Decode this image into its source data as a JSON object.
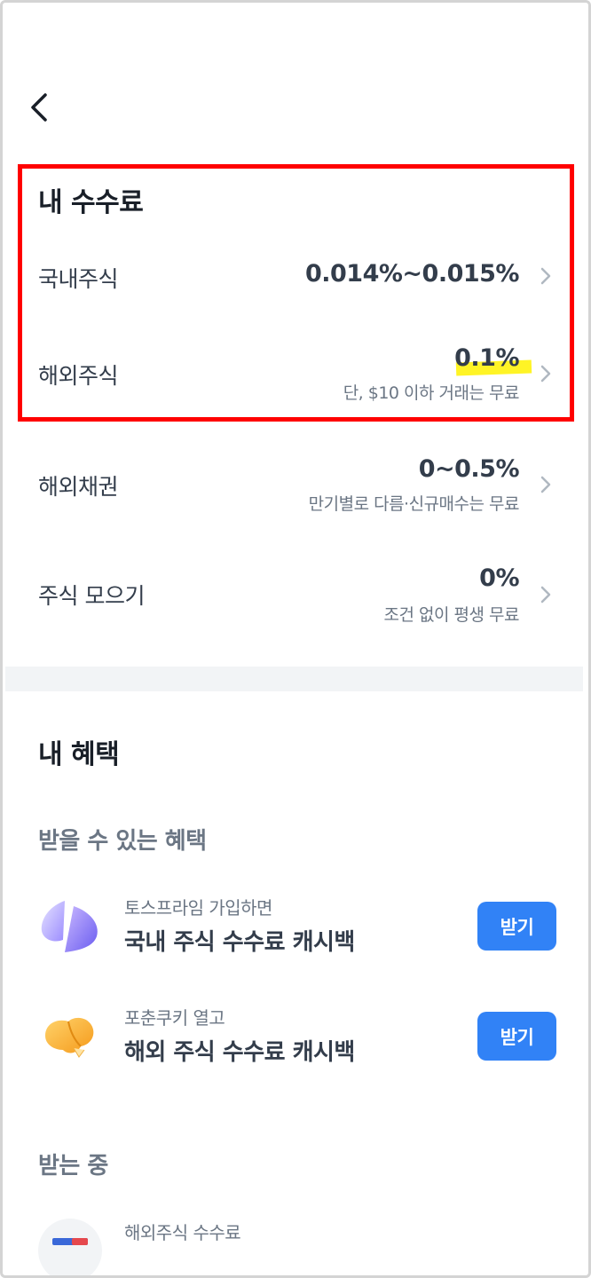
{
  "nav": {
    "back_icon": "chevron-left-icon"
  },
  "fees": {
    "title": "내 수수료",
    "rows": [
      {
        "label": "국내주식",
        "rate": "0.014%~0.015%",
        "note": ""
      },
      {
        "label": "해외주식",
        "rate": "0.1%",
        "note": "단, $10 이하 거래는 무료"
      },
      {
        "label": "해외채권",
        "rate": "0~0.5%",
        "note": "만기별로 다름·신규매수는 무료"
      },
      {
        "label": "주식 모으기",
        "rate": "0%",
        "note": "조건 없이 평생 무료"
      }
    ]
  },
  "benefits": {
    "title": "내 혜택",
    "available_title": "받을 수 있는 혜택",
    "available": [
      {
        "sub": "토스프라임 가입하면",
        "main": "국내 주식 수수료 캐시백",
        "button": "받기",
        "icon": "prime-icon"
      },
      {
        "sub": "포춘쿠키 열고",
        "main": "해외 주식 수수료 캐시백",
        "button": "받기",
        "icon": "fortune-cookie-icon"
      }
    ],
    "receiving_title": "받는 중",
    "receiving": [
      {
        "sub": "해외주식 수수료",
        "icon": "us-flag-icon"
      }
    ]
  },
  "colors": {
    "accent": "#3182f6",
    "highlight_border": "#ff0000",
    "highlight_mark": "#fff200"
  }
}
